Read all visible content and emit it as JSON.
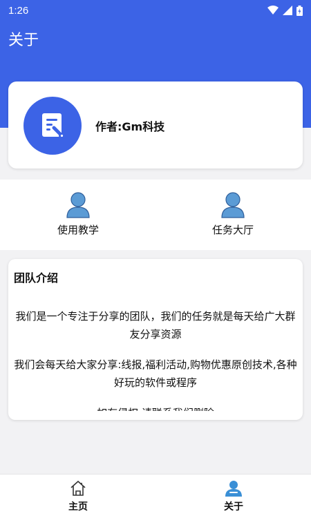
{
  "status_bar": {
    "time": "1:26"
  },
  "header": {
    "title": "关于"
  },
  "author_card": {
    "name": "作者:Gm科技"
  },
  "shortcuts": [
    {
      "label": "使用教学",
      "icon": "person-icon"
    },
    {
      "label": "任务大厅",
      "icon": "person-icon"
    }
  ],
  "team": {
    "title": "团队介绍",
    "paragraphs": [
      "我们是一个专注于分享的团队，我们的任务就是每天给广大群友分享资源",
      "我们会每天给大家分享:线报,福利活动,购物优惠原创技术,各种好玩的软件或程序",
      "如有侵权,请联系我们删除"
    ]
  },
  "bottom_nav": [
    {
      "label": "主页",
      "icon": "home-icon",
      "active": false
    },
    {
      "label": "关于",
      "icon": "person-icon",
      "active": true
    }
  ],
  "colors": {
    "primary": "#3c63e6",
    "icon_blue": "#5b9bd5",
    "background": "#f2f2f4"
  }
}
